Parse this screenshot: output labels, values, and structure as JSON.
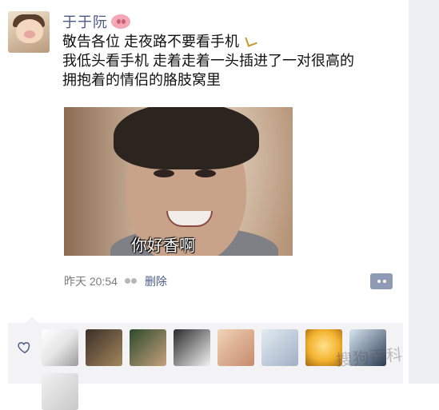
{
  "post": {
    "username": "于于阮",
    "content_lines": [
      "敬告各位 走夜路不要看手机",
      "我低头看手机 走着走着一头插进了一对很高的",
      "拥抱着的情侣的胳肢窝里"
    ],
    "image_caption": "你好香啊",
    "timestamp": "昨天 20:54",
    "delete_label": "删除"
  },
  "likes": {
    "count_visible": 9
  },
  "watermark": {
    "text": "搜狗百科"
  }
}
